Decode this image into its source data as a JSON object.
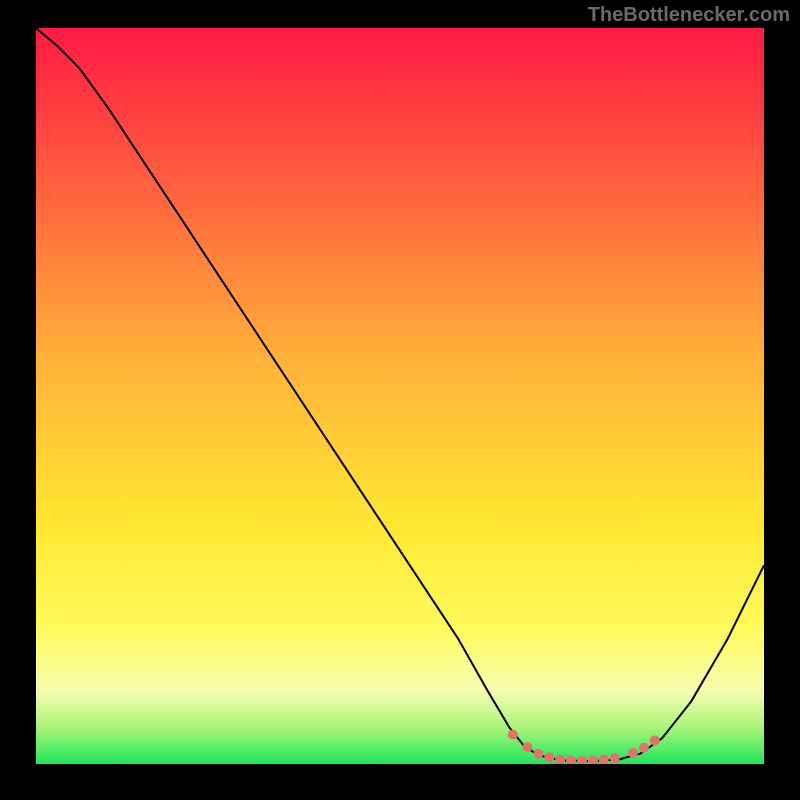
{
  "watermark": "TheBottlenecker.com",
  "chart_data": {
    "type": "line",
    "title": "",
    "xlabel": "",
    "ylabel": "",
    "xlim": [
      0,
      100
    ],
    "ylim": [
      0,
      100
    ],
    "grid": false,
    "background_gradient": {
      "stops": [
        {
          "offset": 0.0,
          "color": "#ff1a44"
        },
        {
          "offset": 0.2,
          "color": "#ff5b3f"
        },
        {
          "offset": 0.45,
          "color": "#ffb13a"
        },
        {
          "offset": 0.68,
          "color": "#ffe833"
        },
        {
          "offset": 0.82,
          "color": "#fdfb5f"
        },
        {
          "offset": 0.9,
          "color": "#f6fcb0"
        },
        {
          "offset": 0.95,
          "color": "#abf57a"
        },
        {
          "offset": 1.0,
          "color": "#1ee65c"
        }
      ]
    },
    "series": [
      {
        "name": "curve",
        "stroke": "#000000",
        "stroke_width": 2,
        "points": [
          {
            "x": 0.0,
            "y": 100.0
          },
          {
            "x": 3.0,
            "y": 97.5
          },
          {
            "x": 6.0,
            "y": 94.5
          },
          {
            "x": 10.0,
            "y": 89.0
          },
          {
            "x": 20.0,
            "y": 74.0
          },
          {
            "x": 30.0,
            "y": 59.0
          },
          {
            "x": 40.0,
            "y": 44.0
          },
          {
            "x": 50.0,
            "y": 29.0
          },
          {
            "x": 58.0,
            "y": 17.0
          },
          {
            "x": 62.0,
            "y": 10.0
          },
          {
            "x": 65.0,
            "y": 5.0
          },
          {
            "x": 67.0,
            "y": 2.5
          },
          {
            "x": 69.0,
            "y": 1.2
          },
          {
            "x": 72.0,
            "y": 0.5
          },
          {
            "x": 76.0,
            "y": 0.4
          },
          {
            "x": 80.0,
            "y": 0.6
          },
          {
            "x": 83.0,
            "y": 1.4
          },
          {
            "x": 86.0,
            "y": 3.5
          },
          {
            "x": 90.0,
            "y": 8.5
          },
          {
            "x": 95.0,
            "y": 17.0
          },
          {
            "x": 100.0,
            "y": 27.0
          }
        ]
      },
      {
        "name": "bottom-dots",
        "type": "scatter",
        "marker_color": "#e2736b",
        "marker_radius": 5,
        "points": [
          {
            "x": 65.5,
            "y": 4.0
          },
          {
            "x": 67.5,
            "y": 2.3
          },
          {
            "x": 69.0,
            "y": 1.4
          },
          {
            "x": 70.5,
            "y": 0.9
          },
          {
            "x": 72.0,
            "y": 0.6
          },
          {
            "x": 73.5,
            "y": 0.5
          },
          {
            "x": 75.0,
            "y": 0.45
          },
          {
            "x": 76.5,
            "y": 0.5
          },
          {
            "x": 78.0,
            "y": 0.6
          },
          {
            "x": 79.5,
            "y": 0.8
          },
          {
            "x": 82.0,
            "y": 1.5
          },
          {
            "x": 83.5,
            "y": 2.2
          },
          {
            "x": 85.0,
            "y": 3.2
          }
        ]
      }
    ]
  }
}
